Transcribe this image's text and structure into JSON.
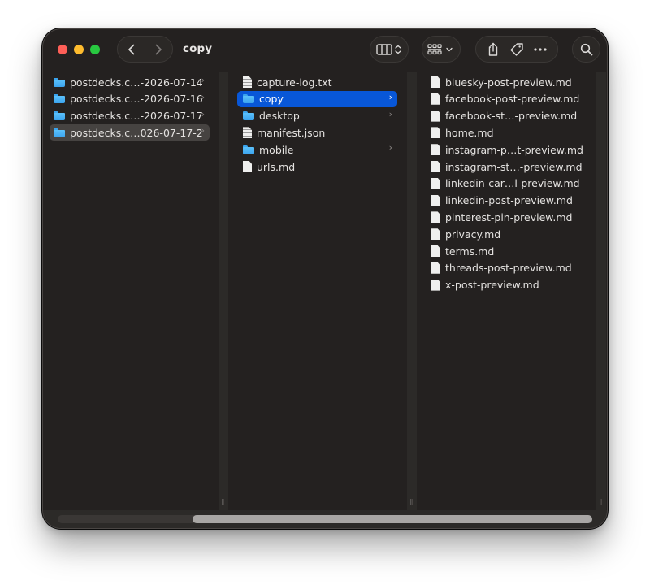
{
  "window": {
    "title": "copy"
  },
  "colors": {
    "accent": "#0857d8",
    "window_bg": "#242120",
    "folder": "#4db3f6"
  },
  "toolbar": {
    "back_icon": "chevron-left-icon",
    "forward_icon": "chevron-right-icon",
    "view_icon": "column-view-icon",
    "group_icon": "grid-group-icon",
    "share_icon": "share-icon",
    "tag_icon": "tag-icon",
    "more_icon": "ellipsis-icon",
    "search_icon": "search-icon"
  },
  "columns": [
    {
      "items": [
        {
          "name": "postdecks.c…-2026-07-14",
          "kind": "folder",
          "has_children": true,
          "state": "none"
        },
        {
          "name": "postdecks.c…-2026-07-16",
          "kind": "folder",
          "has_children": true,
          "state": "none"
        },
        {
          "name": "postdecks.c…-2026-07-17",
          "kind": "folder",
          "has_children": true,
          "state": "none"
        },
        {
          "name": "postdecks.c…026-07-17-2",
          "kind": "folder",
          "has_children": true,
          "state": "path"
        }
      ]
    },
    {
      "items": [
        {
          "name": "capture-log.txt",
          "kind": "text",
          "has_children": false,
          "state": "none"
        },
        {
          "name": "copy",
          "kind": "folder",
          "has_children": true,
          "state": "selected"
        },
        {
          "name": "desktop",
          "kind": "folder",
          "has_children": true,
          "state": "none"
        },
        {
          "name": "manifest.json",
          "kind": "text",
          "has_children": false,
          "state": "none"
        },
        {
          "name": "mobile",
          "kind": "folder",
          "has_children": true,
          "state": "none"
        },
        {
          "name": "urls.md",
          "kind": "doc",
          "has_children": false,
          "state": "none"
        }
      ]
    },
    {
      "items": [
        {
          "name": "bluesky-post-preview.md",
          "kind": "doc",
          "has_children": false,
          "state": "none"
        },
        {
          "name": "facebook-post-preview.md",
          "kind": "doc",
          "has_children": false,
          "state": "none"
        },
        {
          "name": "facebook-st…-preview.md",
          "kind": "doc",
          "has_children": false,
          "state": "none"
        },
        {
          "name": "home.md",
          "kind": "doc",
          "has_children": false,
          "state": "none"
        },
        {
          "name": "instagram-p…t-preview.md",
          "kind": "doc",
          "has_children": false,
          "state": "none"
        },
        {
          "name": "instagram-st…-preview.md",
          "kind": "doc",
          "has_children": false,
          "state": "none"
        },
        {
          "name": "linkedin-car…l-preview.md",
          "kind": "doc",
          "has_children": false,
          "state": "none"
        },
        {
          "name": "linkedin-post-preview.md",
          "kind": "doc",
          "has_children": false,
          "state": "none"
        },
        {
          "name": "pinterest-pin-preview.md",
          "kind": "doc",
          "has_children": false,
          "state": "none"
        },
        {
          "name": "privacy.md",
          "kind": "doc",
          "has_children": false,
          "state": "none"
        },
        {
          "name": "terms.md",
          "kind": "doc",
          "has_children": false,
          "state": "none"
        },
        {
          "name": "threads-post-preview.md",
          "kind": "doc",
          "has_children": false,
          "state": "none"
        },
        {
          "name": "x-post-preview.md",
          "kind": "doc",
          "has_children": false,
          "state": "none"
        }
      ]
    }
  ]
}
